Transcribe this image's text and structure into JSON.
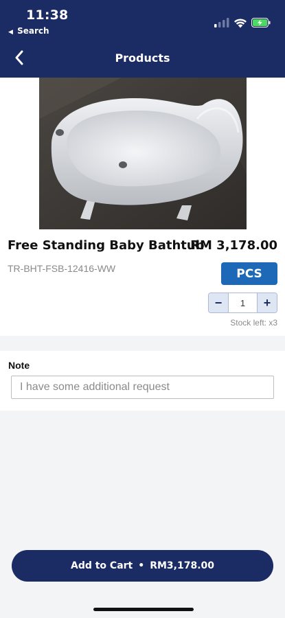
{
  "status_bar": {
    "time": "11:38",
    "back_app": "Search",
    "icons": [
      "signal-icon",
      "wifi-icon",
      "battery-charging-icon"
    ]
  },
  "nav": {
    "title": "Products",
    "back_icon": "chevron-left-icon"
  },
  "product": {
    "name": "Free Standing Baby Bathtub",
    "price": "RM 3,178.00",
    "sku": "TR-BHT-FSB-12416-WW",
    "unit": "PCS",
    "quantity": "1",
    "decrement": "−",
    "increment": "+",
    "stock_left": "Stock left: x3"
  },
  "note": {
    "label": "Note",
    "placeholder": "I have some additional request"
  },
  "cart": {
    "label": "Add to Cart",
    "separator": "•",
    "total": "RM3,178.00"
  },
  "colors": {
    "primary": "#1b2b63",
    "unit_button": "#1e68b8",
    "battery": "#4cd964"
  }
}
